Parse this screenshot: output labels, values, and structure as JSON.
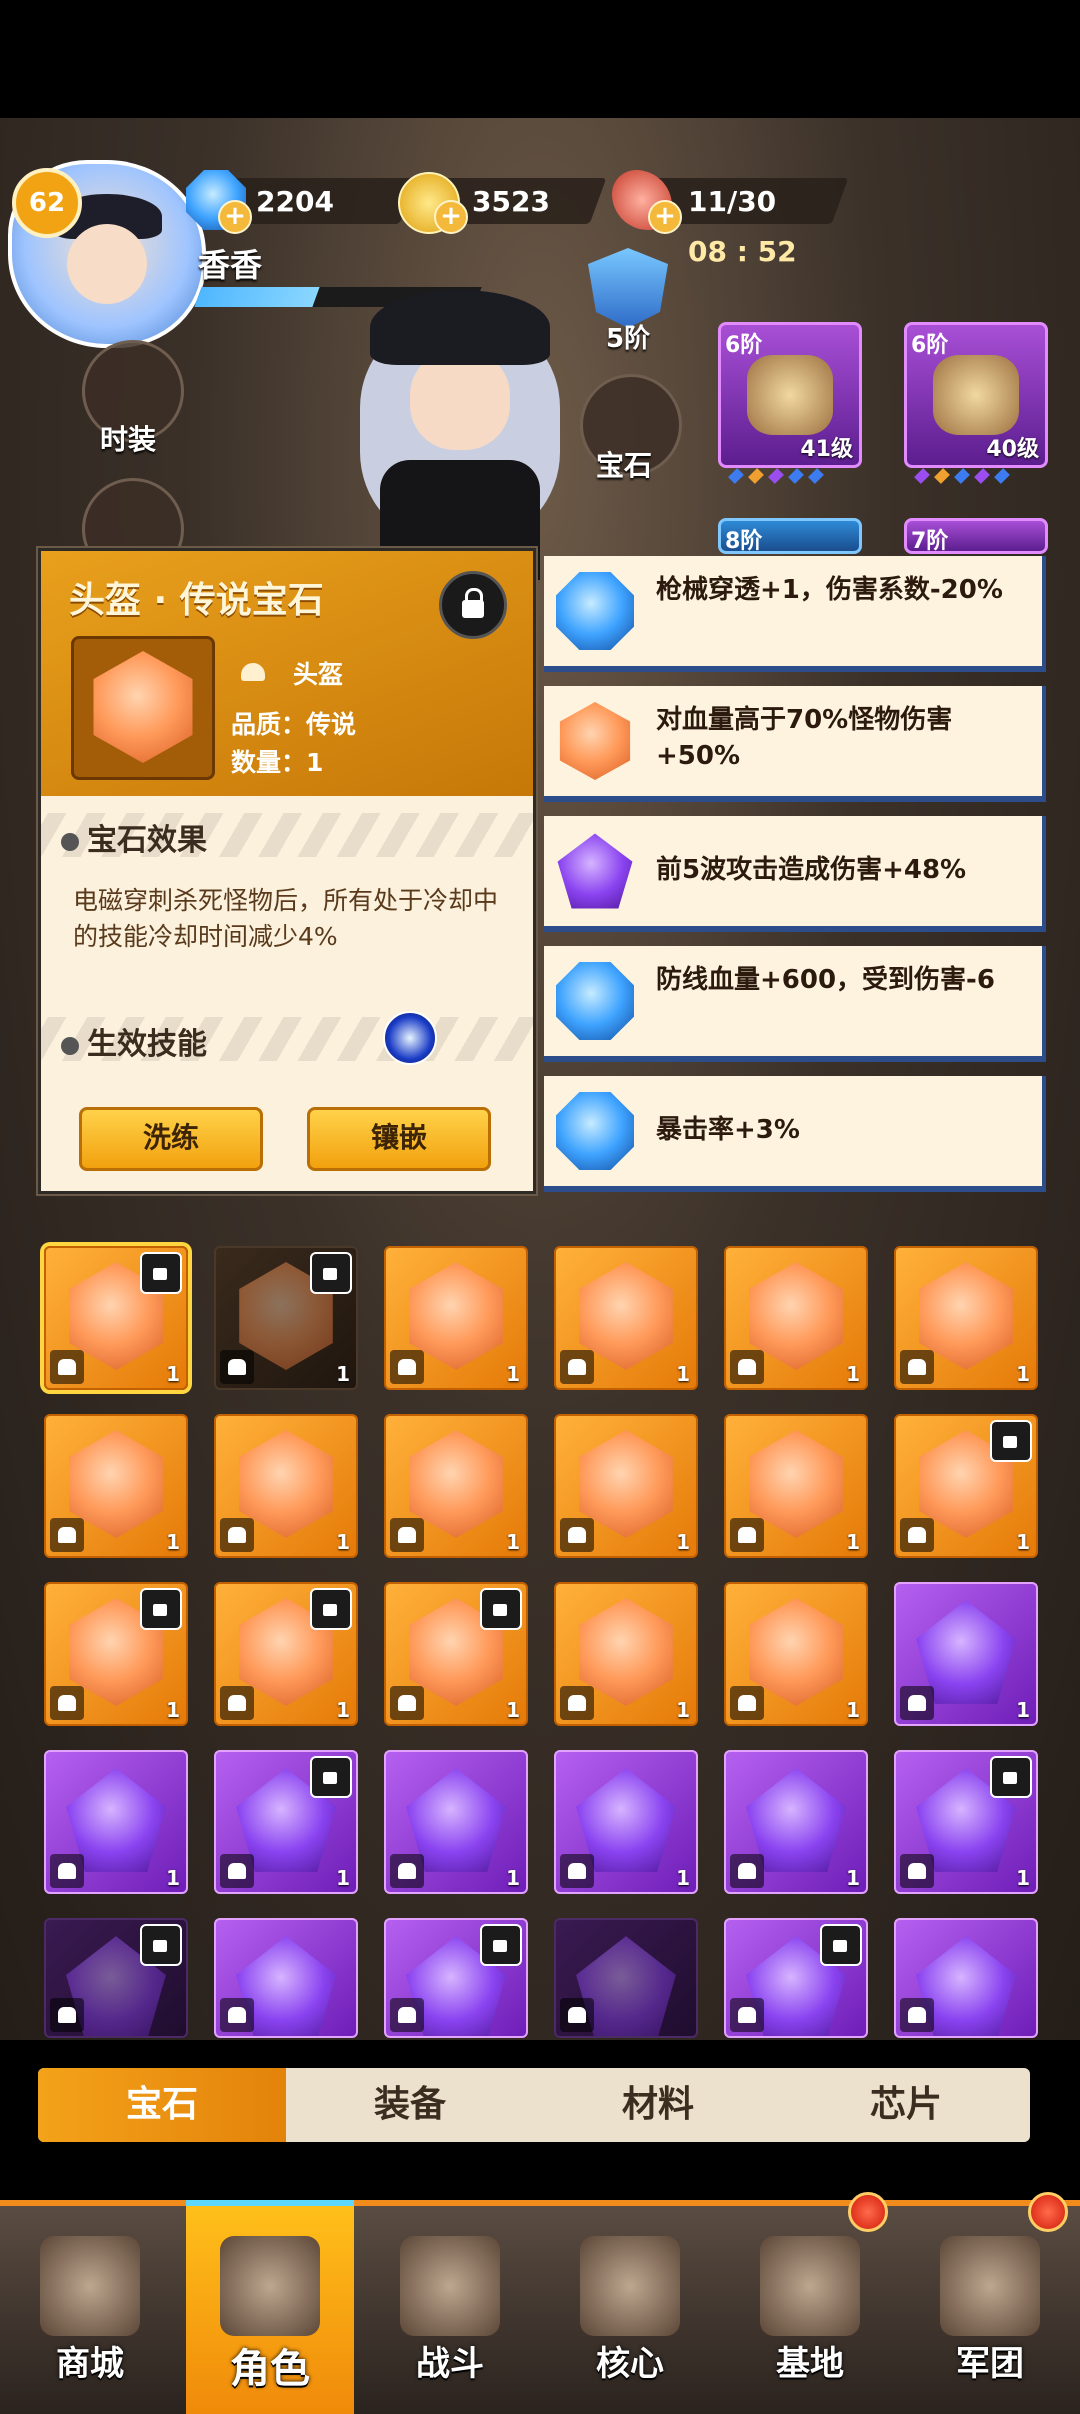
{
  "player": {
    "level": "62",
    "name": "香香",
    "exp_ratio": 0.42
  },
  "resources": {
    "diamonds": "2204",
    "coins": "3523",
    "stamina": "11/30",
    "timer": "08 : 52"
  },
  "side_menu": {
    "fashion_label": "时装",
    "gem_label": "宝石",
    "rank_label": "5阶"
  },
  "equipment": [
    {
      "tier": "6阶",
      "level": "41级",
      "pips": [
        "#3d7cf0",
        "#f0a030",
        "#9a4ef0",
        "#3d7cf0",
        "#3d7cf0"
      ]
    },
    {
      "tier": "6阶",
      "level": "40级",
      "pips": [
        "#9a4ef0",
        "#f0a030",
        "#3d7cf0",
        "#9a4ef0",
        "#3d7cf0"
      ]
    },
    {
      "tier": "8阶",
      "level": ""
    },
    {
      "tier": "7阶",
      "level": ""
    }
  ],
  "detail": {
    "title": "头盔 · 传说宝石",
    "slot": "头盔",
    "quality": "品质：传说",
    "quantity": "数量：1",
    "effect_heading": "宝石效果",
    "effect_text": "电磁穿刺杀死怪物后，所有处于冷却中的技能冷却时间减少4%",
    "skill_heading": "生效技能",
    "refine_button": "洗练",
    "inlay_button": "镶嵌"
  },
  "gem_effects": [
    {
      "text": "枪械穿透+1，伤害系数-20%",
      "shape": "oct"
    },
    {
      "text": "对血量高于70%怪物伤害+50%",
      "shape": "hex"
    },
    {
      "text": "前5波攻击造成伤害+48%",
      "shape": "pent"
    },
    {
      "text": "防线血量+600，受到伤害-6",
      "shape": "oct"
    },
    {
      "text": "暴击率+3%",
      "shape": "oct"
    }
  ],
  "inventory": [
    {
      "c": "orange",
      "lock": true,
      "count": "1",
      "sel": true
    },
    {
      "c": "orange",
      "lock": true,
      "count": "1",
      "dim": true
    },
    {
      "c": "orange",
      "count": "1"
    },
    {
      "c": "orange",
      "count": "1"
    },
    {
      "c": "orange",
      "count": "1"
    },
    {
      "c": "orange",
      "count": "1"
    },
    {
      "c": "orange",
      "count": "1"
    },
    {
      "c": "orange",
      "count": "1"
    },
    {
      "c": "orange",
      "count": "1"
    },
    {
      "c": "orange",
      "count": "1"
    },
    {
      "c": "orange",
      "count": "1"
    },
    {
      "c": "orange",
      "lock": true,
      "count": "1"
    },
    {
      "c": "orange",
      "lock": true,
      "count": "1"
    },
    {
      "c": "orange",
      "lock": true,
      "count": "1"
    },
    {
      "c": "orange",
      "lock": true,
      "count": "1"
    },
    {
      "c": "orange",
      "count": "1"
    },
    {
      "c": "orange",
      "count": "1"
    },
    {
      "c": "purple",
      "count": "1"
    },
    {
      "c": "purple",
      "count": "1"
    },
    {
      "c": "purple",
      "lock": true,
      "count": "1"
    },
    {
      "c": "purple",
      "count": "1"
    },
    {
      "c": "purple",
      "count": "1"
    },
    {
      "c": "purple",
      "count": "1"
    },
    {
      "c": "purple",
      "lock": true,
      "count": "1"
    },
    {
      "c": "purple",
      "lock": true,
      "count": "",
      "dim": true
    },
    {
      "c": "purple",
      "count": ""
    },
    {
      "c": "purple",
      "lock": true,
      "count": ""
    },
    {
      "c": "purple",
      "count": "",
      "dim": true
    },
    {
      "c": "purple",
      "lock": true,
      "count": ""
    },
    {
      "c": "purple",
      "count": ""
    }
  ],
  "tabs": [
    "宝石",
    "装备",
    "材料",
    "芯片"
  ],
  "nav": [
    {
      "label": "商城",
      "notify": false
    },
    {
      "label": "角色",
      "notify": false,
      "active": true
    },
    {
      "label": "战斗",
      "notify": false
    },
    {
      "label": "核心",
      "notify": false
    },
    {
      "label": "基地",
      "notify": true
    },
    {
      "label": "军团",
      "notify": true
    }
  ]
}
